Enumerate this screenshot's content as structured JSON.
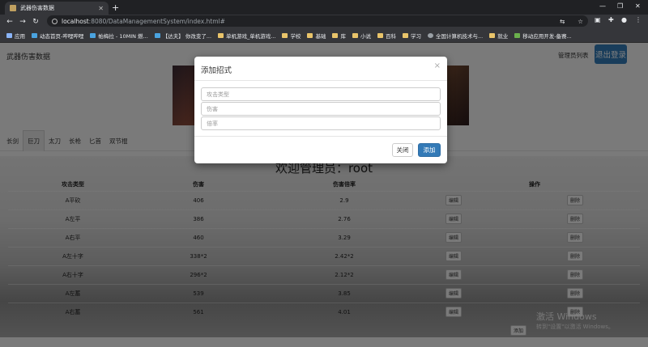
{
  "browser": {
    "tab_title": "武器伤害数据",
    "url_host": "localhost",
    "url_path": ":8080/DataManagementSystem/index.html#",
    "bookmarks": [
      "应用",
      "动态首页-哔哩哔哩",
      "帕梅拉 - 10MIN 燃...",
      "【达夫】 你改变了...",
      "单机游戏_单机游戏...",
      "学校",
      "基础",
      "库",
      "小说",
      "百科",
      "学习",
      "全国计算机技术与...",
      "就业",
      "移动应用开发-备赛..."
    ]
  },
  "site": {
    "title": "武器伤害数据",
    "admin_list": "管理员列表",
    "logout": "退出登录"
  },
  "nav_tabs": [
    "长剑",
    "巨刀",
    "太刀",
    "长枪",
    "匕首",
    "双节棍"
  ],
  "main": {
    "welcome": "欢迎管理员：root",
    "columns": [
      "攻击类型",
      "伤害",
      "伤害倍率",
      "操作"
    ],
    "rows": [
      {
        "type": "A平砍",
        "damage": "406",
        "multiplier": "2.9"
      },
      {
        "type": "A左平",
        "damage": "386",
        "multiplier": "2.76"
      },
      {
        "type": "A右平",
        "damage": "460",
        "multiplier": "3.29"
      },
      {
        "type": "A左十字",
        "damage": "338*2",
        "multiplier": "2.42*2"
      },
      {
        "type": "A右十字",
        "damage": "296*2",
        "multiplier": "2.12*2"
      },
      {
        "type": "A左蓄",
        "damage": "539",
        "multiplier": "3.85"
      },
      {
        "type": "A右蓄",
        "damage": "561",
        "multiplier": "4.01"
      }
    ],
    "edit_label": "编辑",
    "delete_label": "删除",
    "add_label": "添加"
  },
  "windows_watermark": {
    "line1": "激活 Windows",
    "line2": "转到\"设置\"以激活 Windows。"
  },
  "modal": {
    "title": "添加招式",
    "close_symbol": "×",
    "placeholders": [
      "攻击类型",
      "伤害",
      "倍率"
    ],
    "cancel_label": "关闭",
    "submit_label": "添加"
  },
  "colors": {
    "primary": "#337ab7",
    "browser_dark": "#35363a"
  }
}
